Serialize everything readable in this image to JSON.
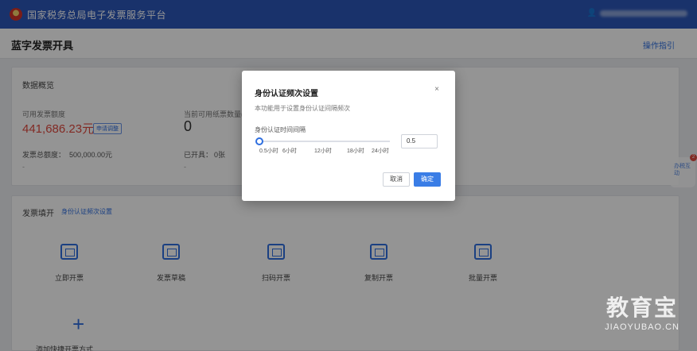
{
  "topbar": {
    "platform_title": "国家税务总局电子发票服务平台",
    "user_icon": "user-icon"
  },
  "header": {
    "page_title": "蓝字发票开具",
    "help_link": "操作指引"
  },
  "overview": {
    "title": "数据概览",
    "available_quota_label": "可用发票额度",
    "available_quota_value": "441,686.23元",
    "quota_badge": "申请调整",
    "available_count_label": "当前可用纸票数量(份)",
    "available_count_value": "0",
    "total_quota_label": "发票总额度：",
    "total_quota_value": "500,000.00元",
    "issued_label": "已开具：",
    "issued_value": "0张",
    "dash": "-"
  },
  "stats": {
    "title": "发票填开",
    "settings_link": "身份认证频次设置",
    "tiles": [
      {
        "label": "立即开票",
        "icon": "invoice-icon"
      },
      {
        "label": "发票草稿",
        "icon": "draft-icon"
      },
      {
        "label": "扫码开票",
        "icon": "qr-icon"
      },
      {
        "label": "复制开票",
        "icon": "copy-icon"
      },
      {
        "label": "批量开票",
        "icon": "batch-icon"
      }
    ],
    "add_label": "添加快捷开票方式"
  },
  "modal": {
    "title": "身份认证频次设置",
    "close": "×",
    "description": "本功能用于设置身份认证间隔频次",
    "slider_label": "身份认证时间间隔",
    "ticks": [
      "0.5小时",
      "6小时",
      "12小时",
      "18小时",
      "24小时"
    ],
    "slider_fraction": 0,
    "input_value": "0.5",
    "cancel": "取消",
    "confirm": "确定"
  },
  "float_widget": {
    "text": "办税互动",
    "badge": "2"
  },
  "watermark": {
    "cn": "教育宝",
    "en": "JIAOYUBAO.CN"
  },
  "colors": {
    "brand_blue": "#2c57b8",
    "accent_blue": "#3a7de6",
    "red": "#e0493e"
  }
}
